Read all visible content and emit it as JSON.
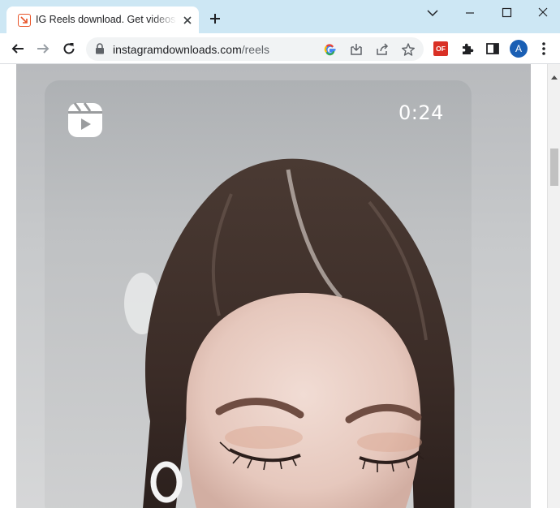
{
  "tab": {
    "title": "IG Reels download. Get videos or",
    "favicon": "download-arrow-icon",
    "accent": "#e8552a"
  },
  "toolbar": {
    "url_host": "instagramdownloads.com",
    "url_path": "/reels"
  },
  "extensions": {
    "badge_label": "OF",
    "badge_color": "#d93025"
  },
  "profile": {
    "initial": "A",
    "color": "#1a5fb4"
  },
  "reel": {
    "duration": "0:24",
    "icon": "reels-icon"
  }
}
